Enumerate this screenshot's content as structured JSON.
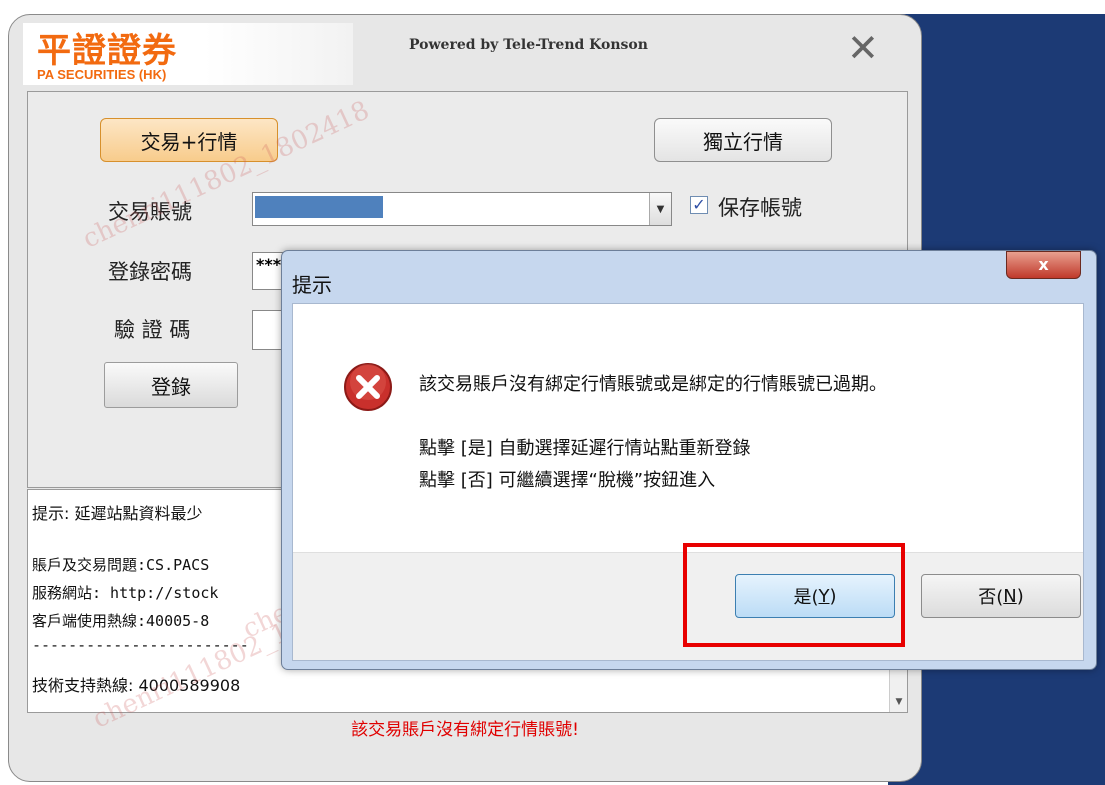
{
  "app": {
    "logo_cn": "平證證券",
    "logo_en": "PA SECURITIES (HK)",
    "powered_by": "Powered by Tele-Trend Konson",
    "close_glyph": "✕"
  },
  "login_form": {
    "trade_button_label": "交易+行情",
    "independent_button_label": "獨立行情",
    "account_label": "交易賬號",
    "password_label": "登錄密碼",
    "password_value": "***",
    "captcha_label": "驗 證 碼",
    "save_account_label": "保存帳號",
    "save_account_checked": true,
    "login_button_label": "登錄"
  },
  "info": {
    "lines": [
      "提示: 延遲站點資料最少",
      "賬戶及交易問題:CS.PACS",
      "服務網站: http://stock",
      "客戶端使用熱線:40005-8",
      "------------------------",
      "技術支持熱線: 4000589908"
    ]
  },
  "status_error": "該交易賬戶沒有綁定行情賬號!",
  "dialog": {
    "title": "提示",
    "close_glyph": "x",
    "message_main": "該交易賬戶沒有綁定行情賬號或是綁定的行情賬號已過期。",
    "message_yes": "點擊 [是] 自動選擇延遲行情站點重新登錄",
    "message_no": "點擊 [否] 可繼續選擇“脫機”按鈕進入",
    "yes_label": "是(",
    "yes_key": "Y",
    "no_label": "否(",
    "no_key": "N",
    "close_paren": ")"
  },
  "watermark": "chenri111802_1802418",
  "colors": {
    "brand_orange": "#f26a10",
    "error_red": "#e00000",
    "highlight_box": "#e80000",
    "desktop_blue": "#1c3a75"
  }
}
